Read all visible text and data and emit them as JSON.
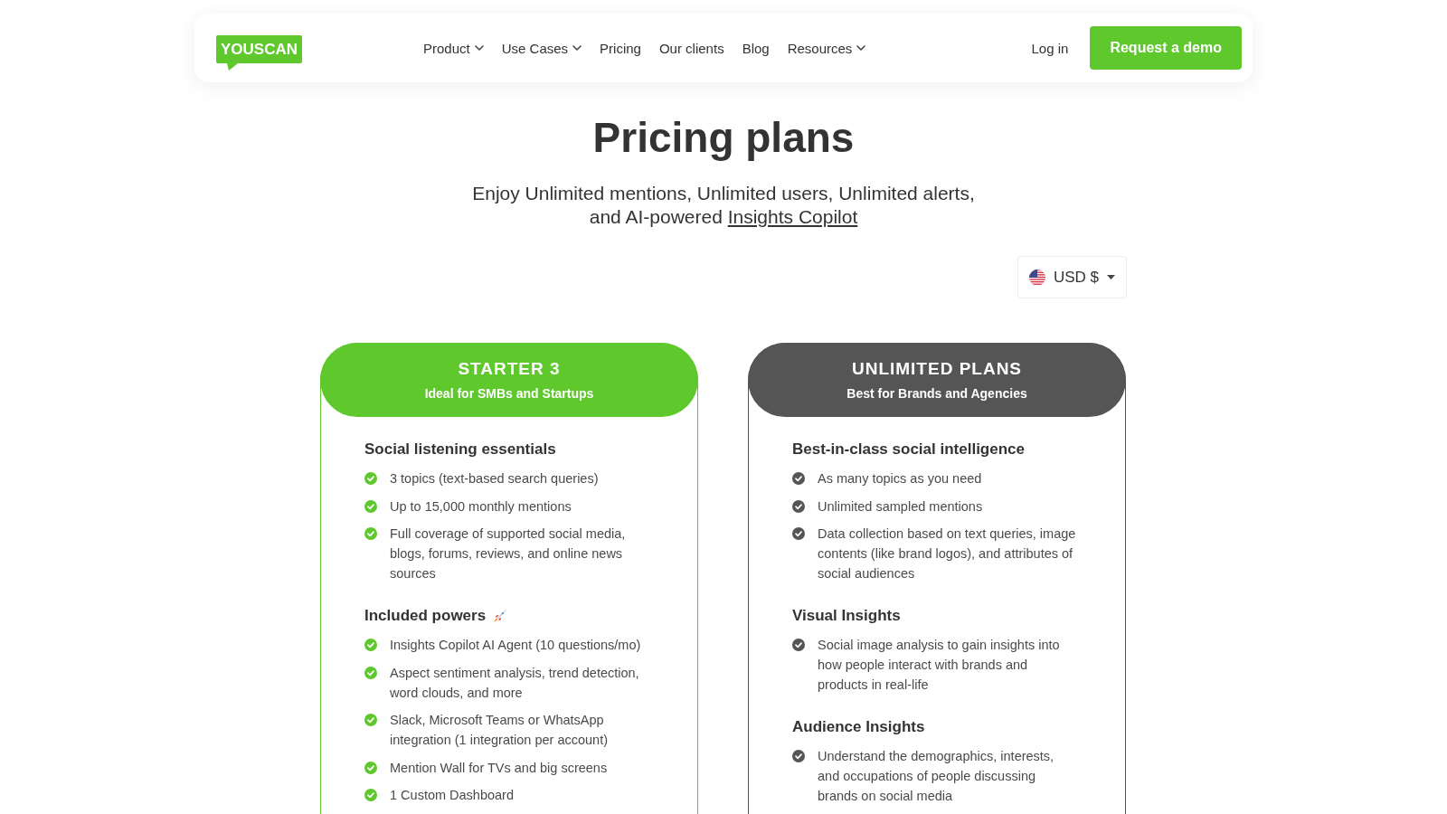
{
  "header": {
    "logo": "YOUSCAN",
    "nav": [
      {
        "label": "Product",
        "has_menu": true
      },
      {
        "label": "Use Cases",
        "has_menu": true
      },
      {
        "label": "Pricing",
        "has_menu": false
      },
      {
        "label": "Our clients",
        "has_menu": false
      },
      {
        "label": "Blog",
        "has_menu": false
      },
      {
        "label": "Resources",
        "has_menu": true
      }
    ],
    "login": "Log in",
    "cta": "Request a demo"
  },
  "hero": {
    "title": "Pricing plans",
    "subtitle": "Enjoy Unlimited mentions, Unlimited users, Unlimited alerts, and AI-powered",
    "subtitle_link": "Insights Copilot"
  },
  "currency": {
    "value": "USD $"
  },
  "plans": [
    {
      "name": "STARTER 3",
      "tagline": "Ideal for SMBs and Startups",
      "color": "#5ec82c",
      "sections": [
        {
          "title": "Social listening essentials",
          "has_icon": false,
          "items": [
            "3 topics (text-based search queries)",
            "Up to 15,000 monthly mentions",
            "Full coverage of supported social media, blogs, forums, reviews, and online news sources"
          ]
        },
        {
          "title": "Included powers",
          "has_icon": true,
          "items": [
            "Insights Copilot AI Agent (10 questions/mo)",
            "Aspect sentiment analysis, trend detection, word clouds, and more",
            "Slack, Microsoft Teams or WhatsApp integration (1 integration per account)",
            "Mention Wall for TVs and big screens",
            "1 Custom Dashboard"
          ]
        }
      ]
    },
    {
      "name": "UNLIMITED PLANS",
      "tagline": "Best for Brands and Agencies",
      "color": "#555555",
      "sections": [
        {
          "title": "Best-in-class social intelligence",
          "has_icon": false,
          "items": [
            "As many topics as you need",
            "Unlimited sampled mentions",
            "Data collection based on text queries, image contents (like brand logos), and attributes of social audiences"
          ]
        },
        {
          "title": "Visual Insights",
          "has_icon": false,
          "items": [
            "Social image analysis to gain insights into how people interact with brands and products in real-life"
          ]
        },
        {
          "title": "Audience Insights",
          "has_icon": false,
          "items": [
            "Understand the demographics, interests, and occupations of people discussing brands on social media"
          ]
        }
      ]
    }
  ]
}
